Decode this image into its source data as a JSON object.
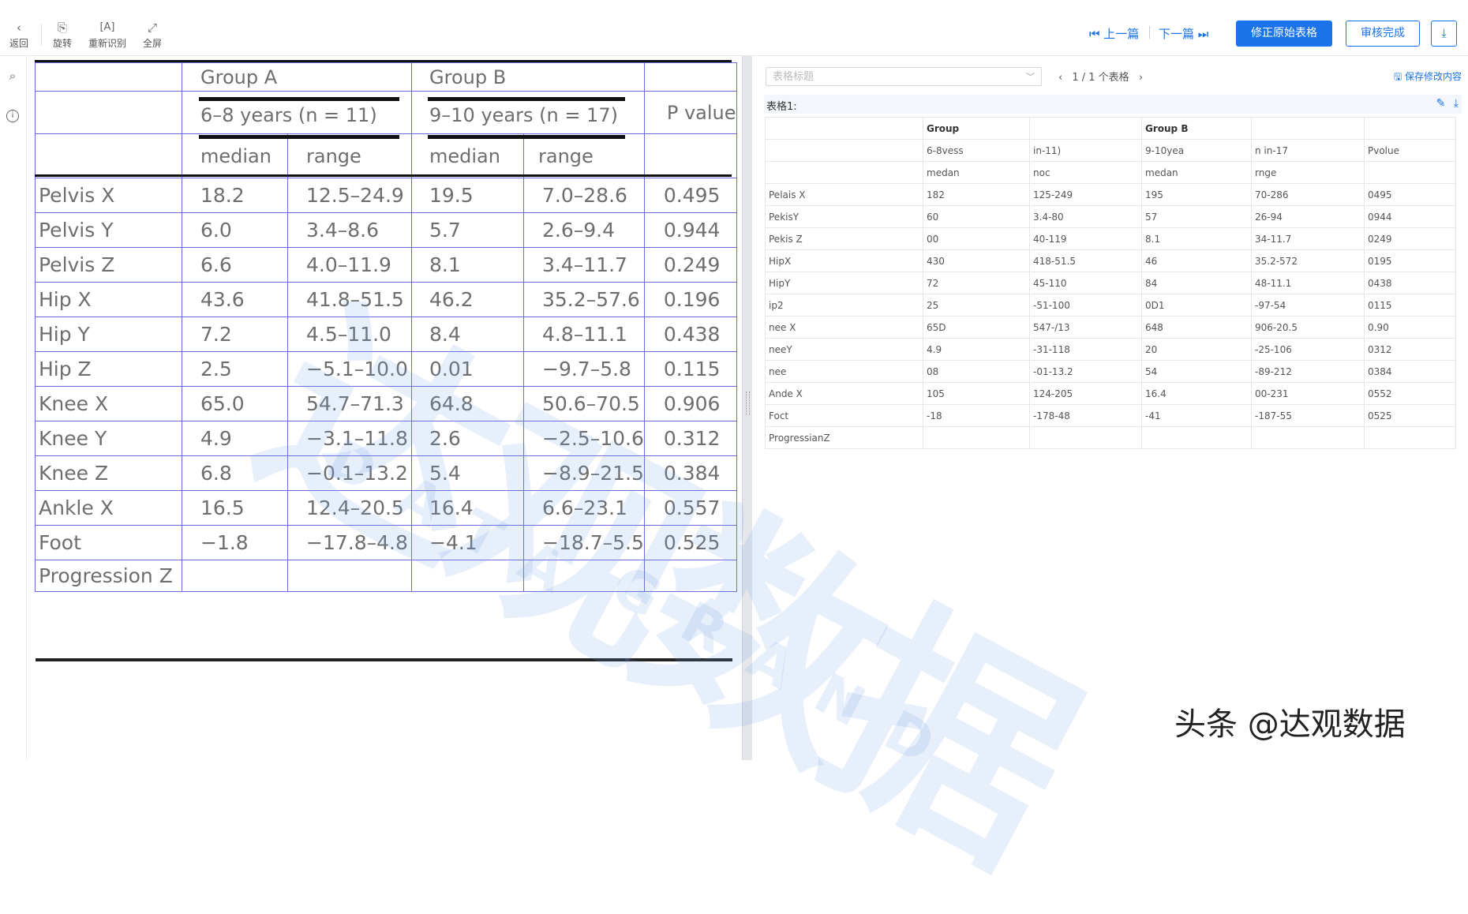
{
  "toolbar": {
    "back": "返回",
    "rotate": "旋转",
    "reocr": "重新识别",
    "fullscreen": "全屏",
    "prev": "上一篇",
    "next": "下一篇",
    "fix_button": "修正原始表格",
    "review_button": "审核完成",
    "icons": {
      "back": "chevron-left-icon",
      "rotate": "rotate-icon",
      "reocr": "ocr-icon",
      "fullscreen": "expand-icon",
      "download": "download-icon"
    }
  },
  "rail": {
    "icons": [
      "search-icon",
      "info-icon"
    ]
  },
  "source_table": {
    "header": {
      "group_a": "Group A",
      "group_b": "Group B",
      "years_a": "6–8 years (n = 11)",
      "years_b": "9–10 years (n = 17)",
      "p_value": "P value",
      "median_a": "median",
      "range_a": "range",
      "median_b": "median",
      "range_b": "range"
    },
    "rows": [
      [
        "Pelvis X",
        "18.2",
        "12.5–24.9",
        "19.5",
        "7.0–28.6",
        "0.495"
      ],
      [
        "Pelvis Y",
        "6.0",
        "3.4–8.6",
        "5.7",
        "2.6–9.4",
        "0.944"
      ],
      [
        "Pelvis Z",
        "6.6",
        "4.0–11.9",
        "8.1",
        "3.4–11.7",
        "0.249"
      ],
      [
        "Hip X",
        "43.6",
        "41.8–51.5",
        "46.2",
        "35.2–57.6",
        "0.196"
      ],
      [
        "Hip Y",
        "7.2",
        "4.5–11.0",
        "8.4",
        "4.8–11.1",
        "0.438"
      ],
      [
        "Hip Z",
        "2.5",
        "−5.1–10.0",
        "0.01",
        "−9.7–5.8",
        "0.115"
      ],
      [
        "Knee X",
        "65.0",
        "54.7–71.3",
        "64.8",
        "50.6–70.5",
        "0.906"
      ],
      [
        "Knee Y",
        "4.9",
        "−3.1–11.8",
        "2.6",
        "−2.5–10.6",
        "0.312"
      ],
      [
        "Knee Z",
        "6.8",
        "−0.1–13.2",
        "5.4",
        "−8.9–21.5",
        "0.384"
      ],
      [
        "Ankle X",
        "16.5",
        "12.4–20.5",
        "16.4",
        "6.6–23.1",
        "0.557"
      ],
      [
        "Foot",
        "−1.8",
        "−17.8–4.8",
        "−4.1",
        "−18.7–5.5",
        "0.525"
      ],
      [
        "Progression Z",
        "",
        "",
        "",
        "",
        ""
      ]
    ]
  },
  "recognition": {
    "title_placeholder": "表格标题",
    "pager": "1 / 1 个表格",
    "save": "保存修改内容",
    "table_label": "表格1:",
    "rows": [
      [
        "",
        "Group",
        "",
        "Group B",
        "",
        ""
      ],
      [
        "",
        "6-8vess",
        "in-11)",
        "9-10yea",
        "n in-17",
        "Pvolue"
      ],
      [
        "",
        "medan",
        "noc",
        "medan",
        "rnge",
        ""
      ],
      [
        "Pelais X",
        "182",
        "125-249",
        "195",
        "70-286",
        "0495"
      ],
      [
        "PekisY",
        "60",
        "3.4-80",
        "57",
        "26-94",
        "0944"
      ],
      [
        "Pekis Z",
        "00",
        "40-119",
        "8.1",
        "34-11.7",
        "0249"
      ],
      [
        "HipX",
        "430",
        "418-51.5",
        "46",
        "35.2-572",
        "0195"
      ],
      [
        "HipY",
        "72",
        "45-110",
        "84",
        "48-11.1",
        "0438"
      ],
      [
        "ip2",
        "25",
        "-51-100",
        "0D1",
        "-97-54",
        "0115"
      ],
      [
        "nee X",
        "65D",
        "547-/13",
        "648",
        "906-20.5",
        "0.90"
      ],
      [
        "neeY",
        "4.9",
        "-31-118",
        "20",
        "-25-106",
        "0312"
      ],
      [
        "nee",
        "08",
        "-01-13.2",
        "54",
        "-89-212",
        "0384"
      ],
      [
        "Ande X",
        "105",
        "124-205",
        "16.4",
        "00-231",
        "0552"
      ],
      [
        "Foct",
        "-18",
        "-178-48",
        "-41",
        "-187-55",
        "0525"
      ],
      [
        "ProgressianZ",
        "",
        "",
        "",
        "",
        ""
      ]
    ]
  },
  "watermark": {
    "cn": "达观数据",
    "en1": "DATA",
    "en2": "GRAND"
  },
  "footer": "头条 @达观数据",
  "colors": {
    "accent": "#1a73e8",
    "grid": "#6a6ad8"
  }
}
